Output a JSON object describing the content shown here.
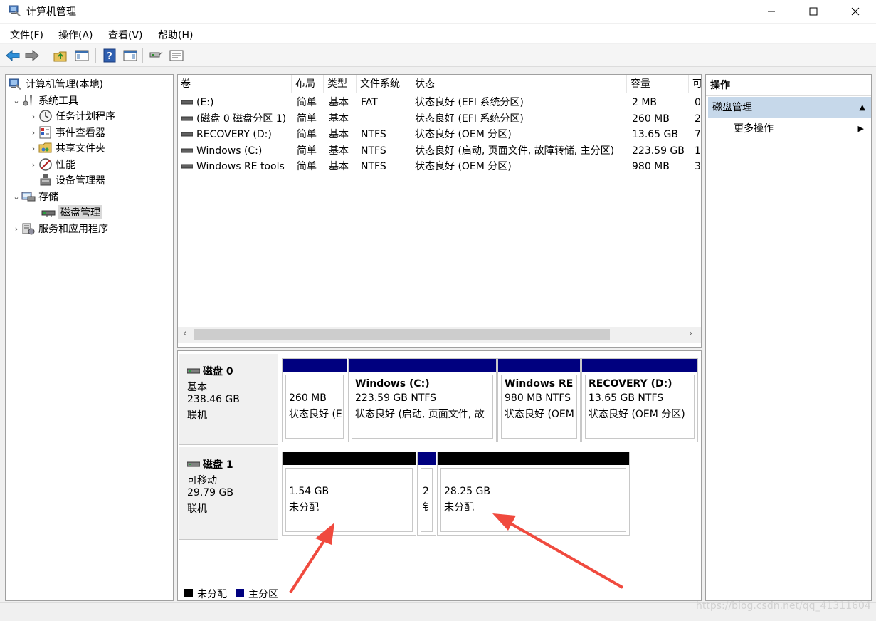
{
  "window": {
    "title": "计算机管理",
    "minimize_glyph": "—",
    "maximize_glyph": "☐",
    "close_glyph": "✕"
  },
  "menu": [
    "文件(F)",
    "操作(A)",
    "查看(V)",
    "帮助(H)"
  ],
  "toolbar": {
    "icons": [
      "back-arrow-icon",
      "forward-arrow-icon",
      "up-folder-icon",
      "show-hide-tree-icon",
      "help-icon",
      "show-hide-action-icon",
      "connect-icon",
      "properties-icon"
    ]
  },
  "tree": {
    "root": "计算机管理(本地)",
    "items": [
      {
        "label": "系统工具",
        "icon": "tools-icon",
        "expanded": true
      },
      {
        "label": "任务计划程序",
        "icon": "clock-icon"
      },
      {
        "label": "事件查看器",
        "icon": "event-viewer-icon"
      },
      {
        "label": "共享文件夹",
        "icon": "shared-folder-icon"
      },
      {
        "label": "性能",
        "icon": "performance-icon"
      },
      {
        "label": "设备管理器",
        "icon": "device-manager-icon"
      },
      {
        "label": "存储",
        "icon": "storage-icon",
        "expanded": true
      },
      {
        "label": "磁盘管理",
        "icon": "disk-management-icon",
        "selected": true
      },
      {
        "label": "服务和应用程序",
        "icon": "services-icon"
      }
    ]
  },
  "volume_table": {
    "columns": [
      "卷",
      "布局",
      "类型",
      "文件系统",
      "状态",
      "容量",
      "可"
    ],
    "rows": [
      {
        "name": "(E:)",
        "layout": "简单",
        "type": "基本",
        "fs": "FAT",
        "status": "状态良好 (EFI 系统分区)",
        "capacity": "2 MB",
        "free": "0"
      },
      {
        "name": "(磁盘 0 磁盘分区 1)",
        "layout": "简单",
        "type": "基本",
        "fs": "",
        "status": "状态良好 (EFI 系统分区)",
        "capacity": "260 MB",
        "free": "2"
      },
      {
        "name": "RECOVERY (D:)",
        "layout": "简单",
        "type": "基本",
        "fs": "NTFS",
        "status": "状态良好 (OEM 分区)",
        "capacity": "13.65 GB",
        "free": "7"
      },
      {
        "name": "Windows (C:)",
        "layout": "简单",
        "type": "基本",
        "fs": "NTFS",
        "status": "状态良好 (启动, 页面文件, 故障转储, 主分区)",
        "capacity": "223.59 GB",
        "free": "1"
      },
      {
        "name": "Windows RE tools",
        "layout": "简单",
        "type": "基本",
        "fs": "NTFS",
        "status": "状态良好 (OEM 分区)",
        "capacity": "980 MB",
        "free": "3"
      }
    ],
    "scroll_left": "‹",
    "scroll_right": "›"
  },
  "disks": [
    {
      "name": "磁盘 0",
      "kind": "基本",
      "size": "238.46 GB",
      "state": "联机",
      "partitions": [
        {
          "title": "",
          "size": "260 MB",
          "status": "状态良好 (E"
        },
        {
          "title": "Windows  (C:)",
          "size": "223.59 GB NTFS",
          "status": "状态良好 (启动, 页面文件, 故"
        },
        {
          "title": "Windows RE",
          "size": "980 MB NTFS",
          "status": "状态良好 (OEM"
        },
        {
          "title": "RECOVERY  (D:)",
          "size": "13.65 GB NTFS",
          "status": "状态良好 (OEM 分区)"
        }
      ]
    },
    {
      "name": "磁盘 1",
      "kind": "可移动",
      "size": "29.79 GB",
      "state": "联机",
      "partitions": [
        {
          "title": "",
          "size": "1.54 GB",
          "status": "未分配"
        },
        {
          "title": "",
          "size": "2",
          "status": "钅"
        },
        {
          "title": "",
          "size": "28.25 GB",
          "status": "未分配"
        }
      ]
    }
  ],
  "legend": [
    {
      "label": "未分配",
      "color": "#000000"
    },
    {
      "label": "主分区",
      "color": "#00007f"
    }
  ],
  "actions": {
    "header": "操作",
    "section": "磁盘管理",
    "section_glyph": "▲",
    "item": "更多操作",
    "item_glyph": "▶"
  },
  "colors": {
    "primary_partition": "#00007f",
    "unallocated": "#000000",
    "selection": "#c6d8ea",
    "annotation_arrow": "#f04a3e"
  },
  "watermark": "https://blog.csdn.net/qq_41311604"
}
